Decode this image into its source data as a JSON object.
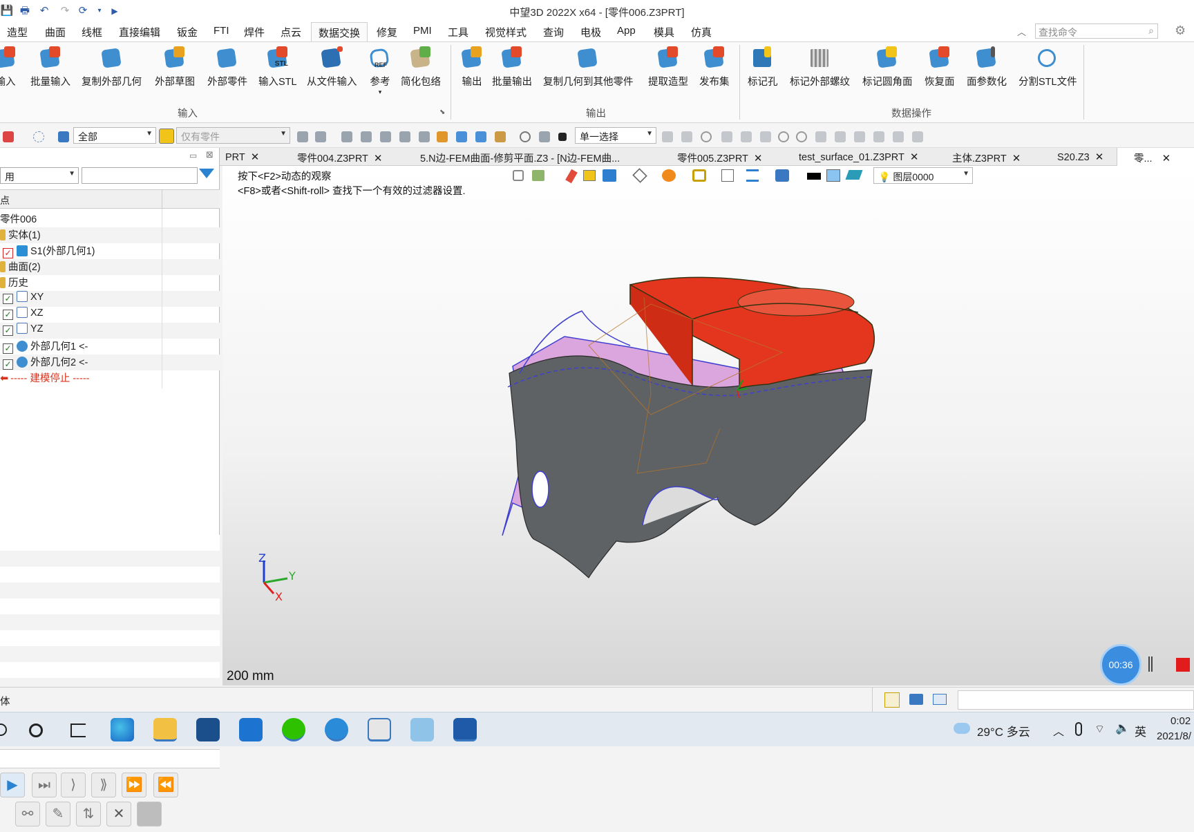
{
  "app": {
    "title": "中望3D 2022X x64 - [零件006.Z3PRT]"
  },
  "menus": [
    "造型",
    "曲面",
    "线框",
    "直接编辑",
    "钣金",
    "FTI",
    "焊件",
    "点云",
    "数据交换",
    "修复",
    "PMI",
    "工具",
    "视觉样式",
    "查询",
    "电极",
    "App",
    "模具",
    "仿真"
  ],
  "active_menu": "数据交换",
  "search": {
    "placeholder": "查找命令"
  },
  "ribbon": {
    "buttons": [
      "输入",
      "批量输入",
      "复制外部几何",
      "外部草图",
      "外部零件",
      "输入STL",
      "从文件输入",
      "参考",
      "简化包络",
      "输出",
      "批量输出",
      "复制几何到其他零件",
      "提取造型",
      "发布集",
      "标记孔",
      "标记外部螺纹",
      "标记圆角面",
      "恢复面",
      "面参数化",
      "分割STL文件"
    ],
    "groups": [
      "输入",
      "输出",
      "数据操作"
    ],
    "stl_badge": "STL",
    "ref_badge": "REF"
  },
  "toolbar2": {
    "filter_value": "全部",
    "part_filter": "仅有零件",
    "select_mode": "单一选择"
  },
  "tabs": [
    "PRT",
    "零件004.Z3PRT",
    "5.N边-FEM曲面-修剪平面.Z3 - [N边-FEM曲...",
    "零件005.Z3PRT",
    "test_surface_01.Z3PRT",
    "主体.Z3PRT",
    "S20.Z3",
    "零..."
  ],
  "close_glyph": "✕",
  "panel": {
    "dropdown": "用",
    "header": "点",
    "tree": [
      "零件006",
      "实体(1)",
      "S1(外部几何1)",
      "曲面(2)",
      "历史",
      "XY",
      "XZ",
      "YZ",
      "外部几何1 <-",
      "外部几何2 <-",
      "----- 建模停止 -----"
    ]
  },
  "viewport": {
    "hint1": "按下<F2>动态的观察",
    "hint2": "<F8>或者<Shift-roll> 查找下一个有效的过滤器设置.",
    "layer": "图层0000",
    "scale": "200 mm",
    "axes": {
      "z": "Z",
      "y": "Y",
      "x": "X"
    }
  },
  "status": {
    "left": "体"
  },
  "recorder": {
    "time": "00:36"
  },
  "taskbar": {
    "weather": "29°C 多云",
    "ime": "英",
    "time": "0:02",
    "date": "2021/8/"
  },
  "colors": {
    "accent": "#3a78c2",
    "shell": "#5e6264",
    "top_part": "#e4351e",
    "surface": "#e6a8e4"
  }
}
